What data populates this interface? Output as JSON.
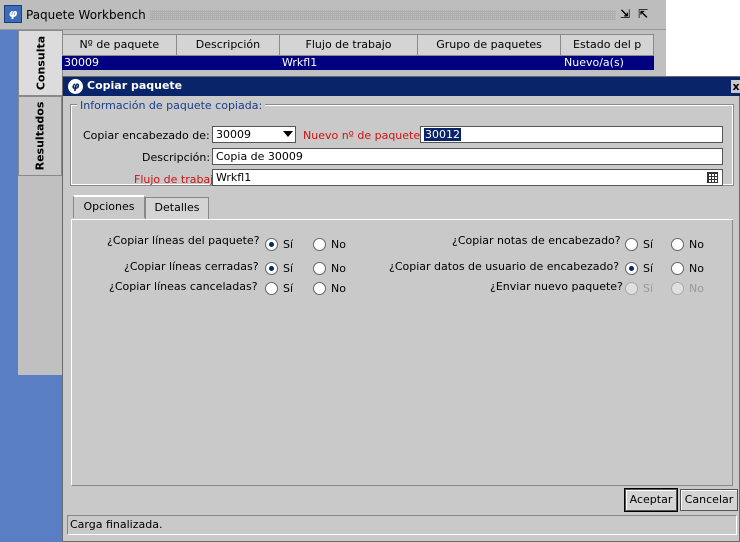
{
  "workbench": {
    "title": "Paquete Workbench",
    "tabs": [
      "Consulta",
      "Resultados"
    ],
    "columns": [
      "Nº de paquete",
      "Descripción",
      "Flujo de trabajo",
      "Grupo de paquetes",
      "Estado del p"
    ],
    "rows": [
      [
        "30009",
        "",
        "Wrkfl1",
        "",
        "Nuevo/a(s)"
      ]
    ]
  },
  "dialog": {
    "title": "Copiar paquete",
    "close": "x",
    "group_title": "Información de paquete copiada:",
    "copy_header_label": "Copiar encabezado de:",
    "copy_header_value": "30009",
    "new_number_label": "Nuevo nº de paquete:",
    "new_number_value": "30012",
    "description_label": "Descripción:",
    "description_value": "Copia de  30009",
    "workflow_label": "Flujo de trabajo:",
    "workflow_value": "Wrkfl1",
    "tabs": [
      "Opciones",
      "Detalles"
    ],
    "options": {
      "q1": "¿Copiar líneas del paquete?",
      "q2": "¿Copiar líneas cerradas?",
      "q3": "¿Copiar líneas canceladas?",
      "q4": "¿Copiar notas de encabezado?",
      "q5": "¿Copiar datos de usuario de encabezado?",
      "q6": "¿Enviar nuevo paquete?",
      "yes": "Sí",
      "no": "No",
      "selected": {
        "q1": "Sí",
        "q2": "Sí",
        "q3": "",
        "q4": "",
        "q5": "Sí",
        "q6": ""
      }
    },
    "accept": "Aceptar",
    "cancel": "Cancelar",
    "status": "Carga finalizada."
  },
  "colors": {
    "title_bar": "#0a246a",
    "selected_row": "#000080",
    "required_label": "#d01010",
    "side_blue": "#5a7ec4"
  }
}
